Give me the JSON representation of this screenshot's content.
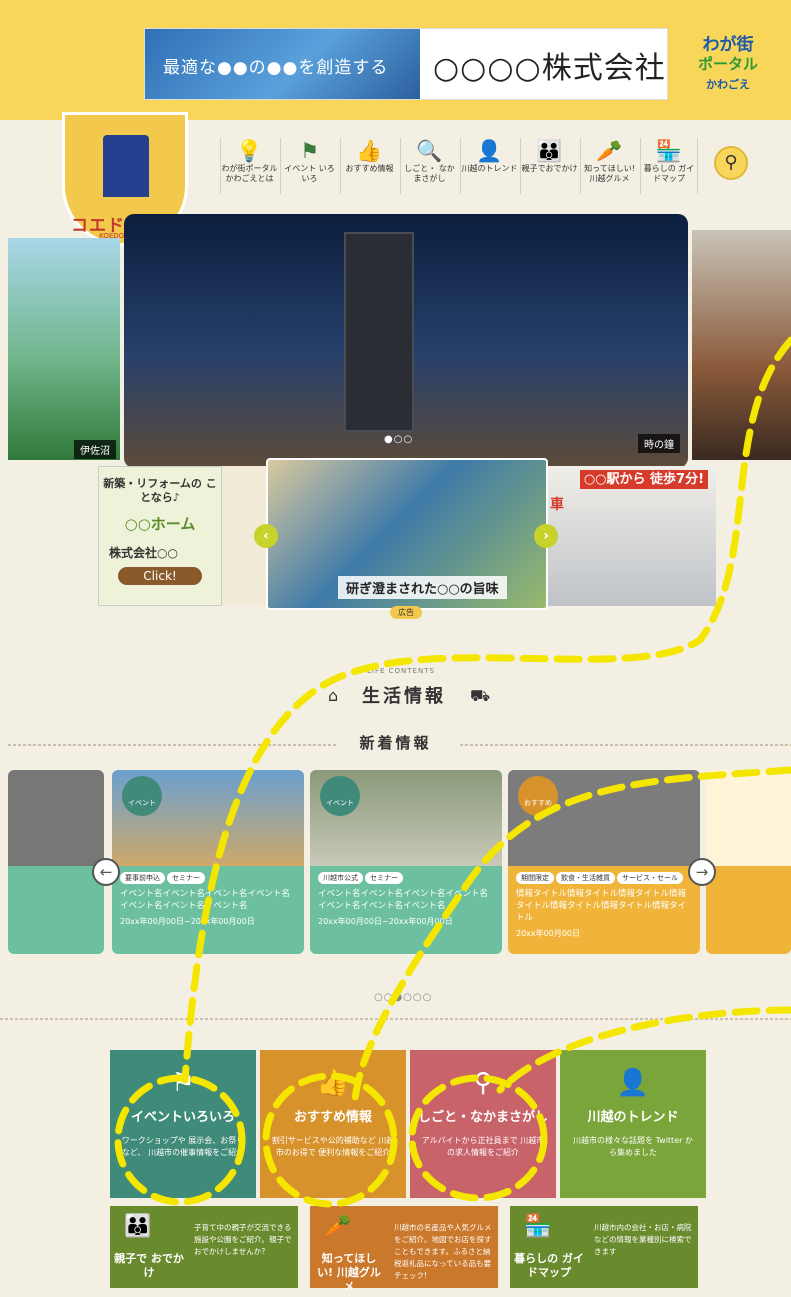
{
  "banner": {
    "tagline": "最適な●●の●●を創造する",
    "company": "○○○○株式会社"
  },
  "portal": {
    "line1": "わが街",
    "line2": "ポータル",
    "line3": "かわごえ"
  },
  "logo": {
    "name": "コエドカラー",
    "sub": "KOEDO COLOR"
  },
  "nav": [
    {
      "icon": "💡",
      "label": "わが街ポータル かわごえとは"
    },
    {
      "icon": "⚑",
      "label": "イベント いろいろ"
    },
    {
      "icon": "👍",
      "label": "おすすめ情報"
    },
    {
      "icon": "🔍",
      "label": "しごと・ なかまさがし"
    },
    {
      "icon": "👤",
      "label": "川越のトレンド"
    },
    {
      "icon": "👪",
      "label": "親子でおでかけ"
    },
    {
      "icon": "🥕",
      "label": "知ってほしい! 川越グルメ"
    },
    {
      "icon": "🏪",
      "label": "暮らしの ガイドマップ"
    }
  ],
  "hero": {
    "left_caption": "伊佐沼",
    "main_caption": "時の鐘",
    "dots": "●○○"
  },
  "ads": {
    "left": {
      "title": "新築・リフォームの ことなら♪",
      "home": "○○ホーム",
      "company": "株式会社○○",
      "click": "Click!"
    },
    "main": {
      "title": "研ぎ澄まされた○○の旨味"
    },
    "car": {
      "label": "車",
      "station": "○○駅から 徒歩7分!"
    },
    "label": "広告"
  },
  "life": {
    "en": "LIFE CONTENTS",
    "jp": "生活情報"
  },
  "news": {
    "heading": "新着情報",
    "dots": "○○●○○○",
    "cards": [
      {
        "badge": "イベント",
        "tags": [
          "要事前申込",
          "セミナー"
        ],
        "title": "イベント名イベント名イベント名イベント名イベント名イベント名イベント名",
        "date": "20xx年00月00日~20xx年00月00日"
      },
      {
        "badge": "イベント",
        "tags": [
          "川越市公式",
          "セミナー"
        ],
        "title": "イベント名イベント名イベント名イベント名イベント名イベント名イベント名",
        "date": "20xx年00月00日~20xx年00月00日"
      },
      {
        "badge": "おすすめ",
        "tags": [
          "期間限定",
          "飲食・生活雑貨",
          "サービス・セール"
        ],
        "title": "情報タイトル情報タイトル情報タイトル情報タイトル情報タイトル情報タイトル情報タイトル",
        "date": "20xx年00月00日"
      }
    ]
  },
  "tiles": [
    {
      "title": "イベントいろいろ",
      "desc": "ワークショップや 展示会、お祭りなど、 川越市の催事情報をご紹介",
      "color": "#3f8a78"
    },
    {
      "title": "おすすめ情報",
      "desc": "割引サービスや公的補助など 川越市のお得で 便利な情報をご紹介",
      "color": "#d8922c"
    },
    {
      "title": "しごと・なかまさがし",
      "desc": "アルバイトから正社員まで 川越市の求人情報をご紹介",
      "color": "#c9636a"
    },
    {
      "title": "川越のトレンド",
      "desc": "川越市の様々な話題を Twitter から集めました",
      "color": "#7aa53a"
    }
  ],
  "small_tiles": [
    {
      "title": "親子で おでかけ",
      "desc": "子育て中の親子が交流できる施設や公園をご紹介。親子でおでかけしませんか?",
      "color": "#6a8a2e"
    },
    {
      "title": "知ってほしい! 川越グルメ",
      "desc": "川越市の名産品や人気グルメをご紹介。地図でお店を探すこともできます。ふるさと納税返礼品になっている品も要チェック!",
      "color": "#c9782c"
    },
    {
      "title": "暮らしの ガイドマップ",
      "desc": "川越市内の会社・お店・病院などの情報を業種別に検索できます",
      "color": "#6a8a2e"
    }
  ]
}
